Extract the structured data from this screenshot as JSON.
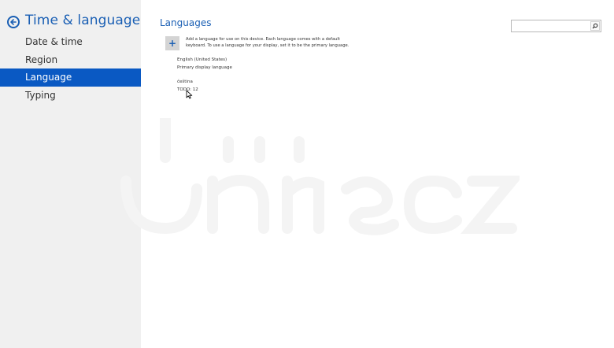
{
  "sidebar": {
    "title": "Time & language",
    "items": [
      {
        "label": "Date & time",
        "active": false
      },
      {
        "label": "Region",
        "active": false
      },
      {
        "label": "Language",
        "active": true
      },
      {
        "label": "Typing",
        "active": false
      }
    ]
  },
  "main": {
    "title": "Languages",
    "search": {
      "value": "",
      "placeholder": ""
    },
    "add_language": {
      "button_label": "+",
      "description": "Add a language for use on this device. Each language comes with a default keyboard. To use a language for your display, set it to be the primary language."
    },
    "languages": [
      {
        "name": "English (United States)",
        "status": "Primary display language"
      },
      {
        "name": "čeština",
        "status": "TODO: 12"
      }
    ]
  },
  "colors": {
    "accent": "#1a5fb4",
    "selected_bg": "#0a59c3",
    "sidebar_bg": "#f0f0f0"
  }
}
